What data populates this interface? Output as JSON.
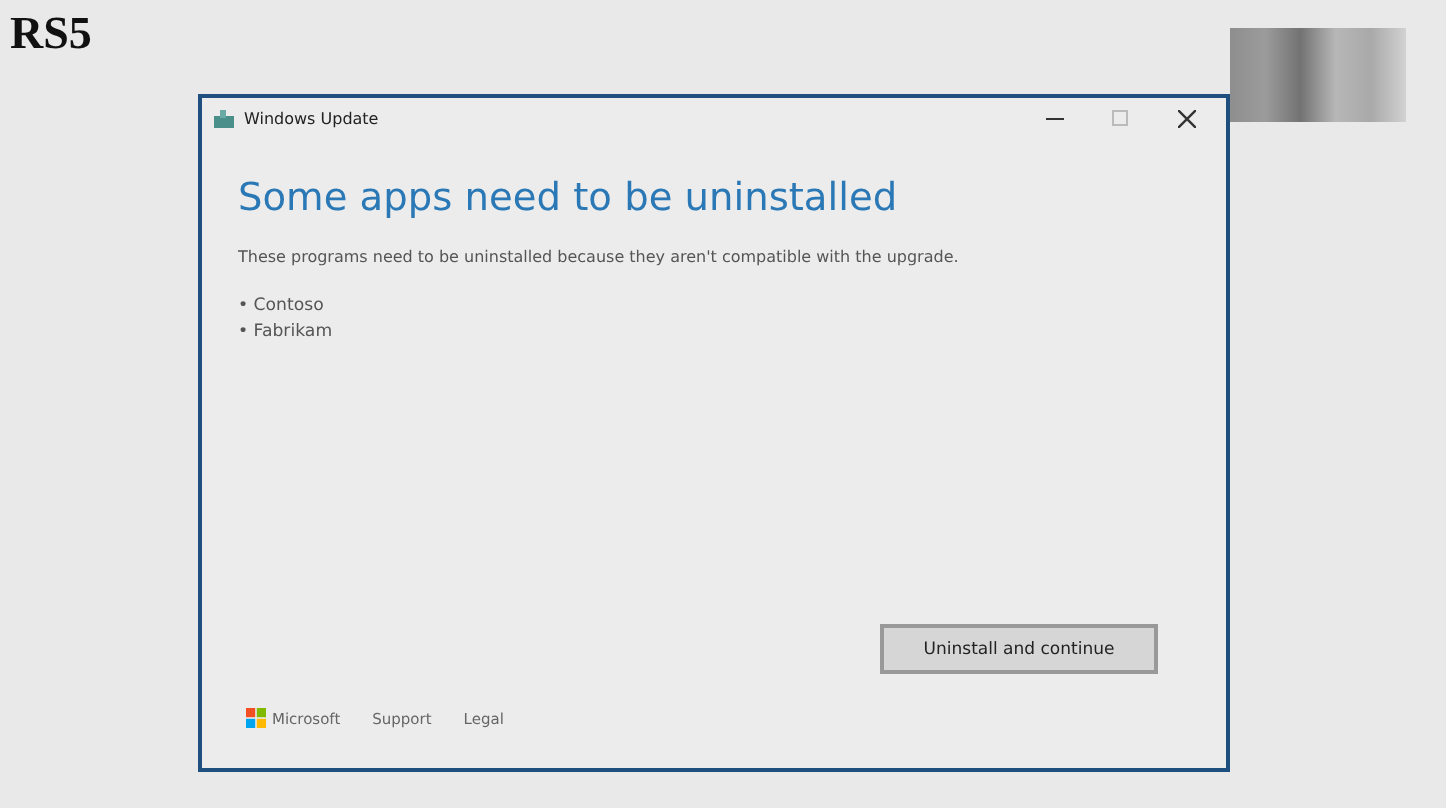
{
  "slide_title": "RS5",
  "window": {
    "title": "Windows Update",
    "heading": "Some apps need to be uninstalled",
    "message": "These programs need to be uninstalled because they aren't compatible with the upgrade.",
    "apps": [
      "• Contoso",
      "• Fabrikam"
    ],
    "primary_button": "Uninstall and continue",
    "footer": {
      "brand": "Microsoft",
      "links": [
        "Support",
        "Legal"
      ]
    }
  }
}
